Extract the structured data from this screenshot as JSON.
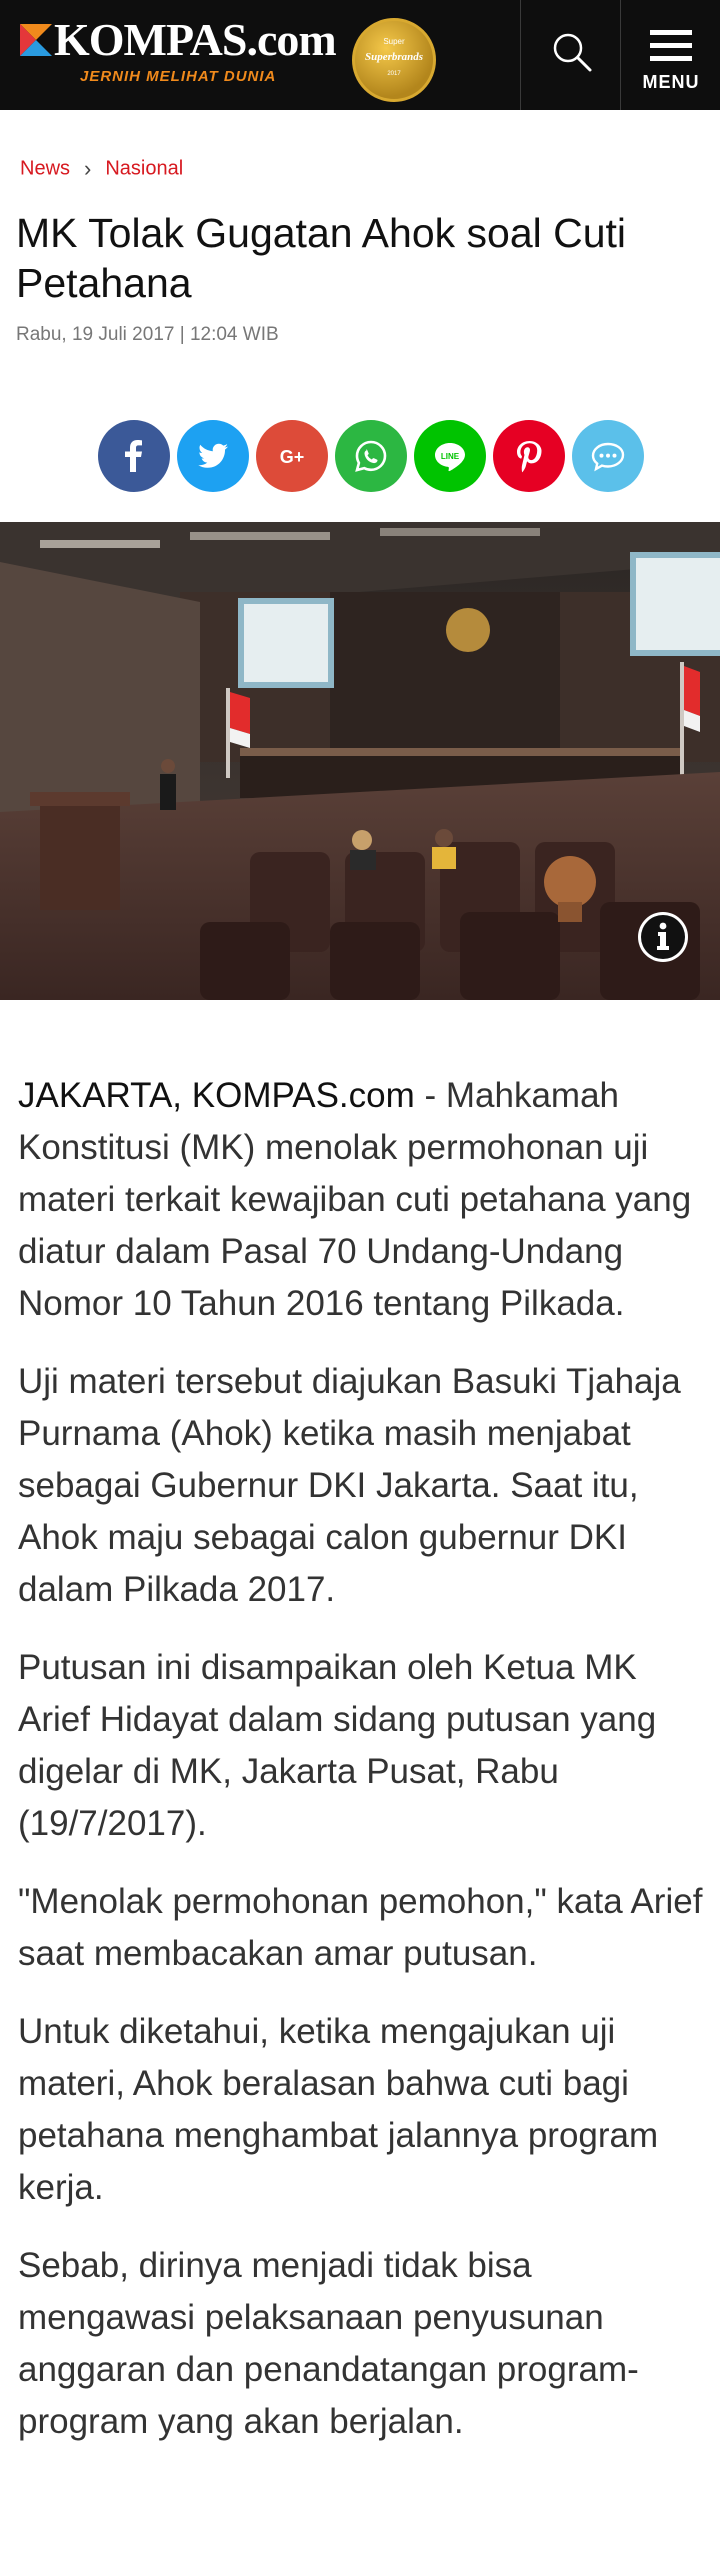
{
  "header": {
    "logo_text": "KOMPAS.com",
    "tagline": "JERNIH MELIHAT DUNIA",
    "badge_top": "Super",
    "badge_mid": "Superbrands",
    "badge_bot": "2017",
    "menu_label": "MENU"
  },
  "breadcrumb": {
    "items": [
      "News",
      "Nasional"
    ],
    "separator": "›"
  },
  "article": {
    "title": "MK Tolak Gugatan Ahok soal Cuti Petahana",
    "date": "Rabu, 19 Juli 2017 | 12:04 WIB",
    "dateline": "JAKARTA, KOMPAS.com",
    "paragraphs": [
      " - Mahkamah Konstitusi (MK) menolak permohonan uji materi terkait kewajiban cuti petahana yang diatur dalam Pasal 70 Undang-Undang Nomor 10 Tahun 2016 tentang Pilkada.",
      "Uji materi tersebut diajukan Basuki Tjahaja Purnama (Ahok) ketika masih menjabat sebagai Gubernur DKI Jakarta. Saat itu, Ahok maju sebagai calon gubernur DKI dalam Pilkada 2017.",
      "Putusan ini disampaikan oleh Ketua MK Arief Hidayat dalam sidang putusan yang digelar di MK, Jakarta Pusat, Rabu (19/7/2017).",
      "\"Menolak permohonan pemohon,\" kata Arief saat membacakan amar putusan.",
      "Untuk diketahui, ketika mengajukan uji materi, Ahok beralasan bahwa cuti bagi petahana menghambat jalannya program kerja.",
      "Sebab, dirinya menjadi tidak bisa mengawasi pelaksanaan penyusunan anggaran dan penandatangan program-program yang akan berjalan."
    ]
  },
  "share": {
    "buttons": [
      {
        "name": "facebook",
        "color": "#3b5998",
        "glyph": "f"
      },
      {
        "name": "twitter",
        "color": "#1da1f2",
        "glyph": "twitter"
      },
      {
        "name": "google-plus",
        "color": "#dd4b39",
        "glyph": "G+"
      },
      {
        "name": "whatsapp",
        "color": "#2cb742",
        "glyph": "whatsapp"
      },
      {
        "name": "line",
        "color": "#00c300",
        "glyph": "LINE"
      },
      {
        "name": "pinterest",
        "color": "#e60023",
        "glyph": "P"
      },
      {
        "name": "comment",
        "color": "#5bc0ea",
        "glyph": "comment"
      }
    ]
  },
  "colors": {
    "accent": "#d71920",
    "header_bg": "#0e0e0e",
    "logo_orange": "#f08a1c"
  }
}
